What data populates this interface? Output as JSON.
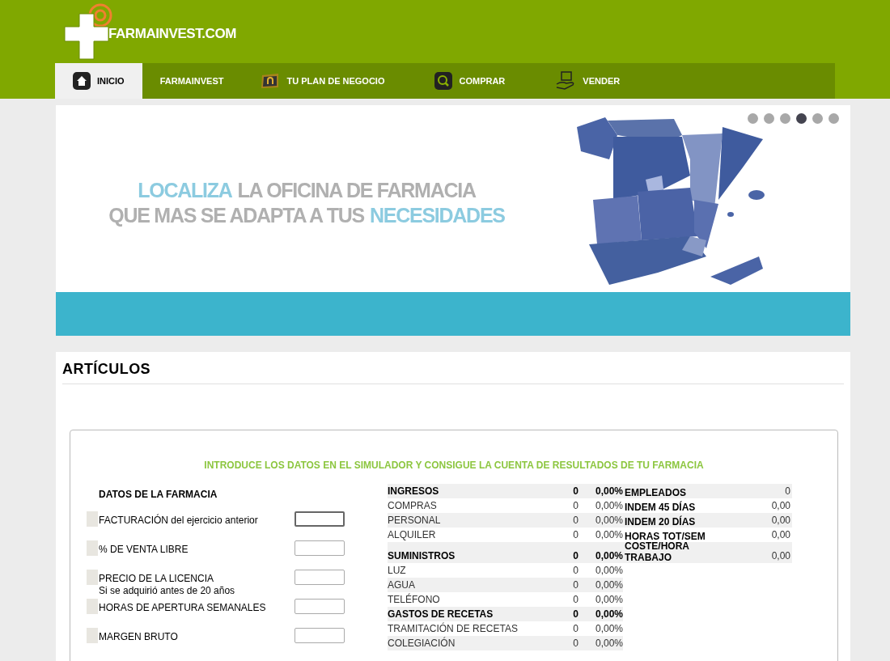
{
  "logo": {
    "text": "FARMAINVEST.COM"
  },
  "nav": [
    {
      "label": "INICIO",
      "selected": true
    },
    {
      "label": "FARMAINVEST",
      "selected": false
    },
    {
      "label": "TU PLAN DE NEGOCIO",
      "selected": false
    },
    {
      "label": "COMPRAR",
      "selected": false
    },
    {
      "label": "VENDER",
      "selected": false
    }
  ],
  "banner": {
    "lines": [
      [
        {
          "text": "LOCALIZA",
          "highlight": true
        },
        {
          "text": "LA OFICINA DE FARMACIA",
          "highlight": false
        }
      ],
      [
        {
          "text": "QUE MAS SE ADAPTA A TUS",
          "highlight": false
        },
        {
          "text": "NECESIDADES",
          "highlight": true
        }
      ]
    ],
    "dots": [
      {
        "selected": false
      },
      {
        "selected": false
      },
      {
        "selected": false
      },
      {
        "selected": true
      },
      {
        "selected": false
      },
      {
        "selected": false
      }
    ]
  },
  "articles": {
    "title": "ARTÍCULOS"
  },
  "simulator": {
    "intro": "INTRODUCE LOS DATOS EN EL SIMULADOR Y CONSIGUE LA CUENTA DE RESULTADOS DE TU FARMACIA",
    "form_title": "DATOS DE LA FARMACIA",
    "fields": [
      {
        "label": "FACTURACIÓN del ejercicio anterior",
        "focused": true
      },
      {
        "label": "% DE VENTA LIBRE",
        "focused": false
      },
      {
        "label": "PRECIO DE LA LICENCIA",
        "note": "Si se adquirió antes de 20 años",
        "focused": false
      },
      {
        "label": "HORAS DE APERTURA SEMANALES",
        "focused": false
      },
      {
        "label": "MARGEN BRUTO",
        "focused": false
      }
    ],
    "results": [
      {
        "kind": "group",
        "label": "INGRESOS",
        "value": "0",
        "percent": "0,00%"
      },
      {
        "kind": "item",
        "label": "COMPRAS",
        "value": "0",
        "percent": "0,00%"
      },
      {
        "kind": "item",
        "label": "PERSONAL",
        "value": "0",
        "percent": "0,00%"
      },
      {
        "kind": "item",
        "label": "ALQUILER",
        "value": "0",
        "percent": "0,00%"
      },
      {
        "kind": "group",
        "label": "SUMINISTROS",
        "value": "0",
        "percent": "0,00%"
      },
      {
        "kind": "item",
        "label": "LUZ",
        "value": "0",
        "percent": "0,00%"
      },
      {
        "kind": "item",
        "label": "AGUA",
        "value": "0",
        "percent": "0,00%"
      },
      {
        "kind": "item",
        "label": "TELÉFONO",
        "value": "0",
        "percent": "0,00%"
      },
      {
        "kind": "group",
        "label": "GASTOS DE RECETAS",
        "value": "0",
        "percent": "0,00%"
      },
      {
        "kind": "item",
        "label": "TRAMITACIÓN DE RECETAS",
        "value": "0",
        "percent": "0,00%"
      },
      {
        "kind": "item",
        "label": "COLEGIACIÓN",
        "value": "0",
        "percent": "0,00%"
      }
    ],
    "staff": [
      {
        "label": "EMPLEADOS",
        "value": "0"
      },
      {
        "label": "INDEM 45 DÍAS",
        "value": "0,00"
      },
      {
        "label": "INDEM 20 DÍAS",
        "value": "0,00"
      },
      {
        "label": "HORAS TOT/SEM",
        "value": "0,00"
      },
      {
        "label": "COSTE/HORA TRABAJO",
        "value": "0,00"
      }
    ]
  }
}
